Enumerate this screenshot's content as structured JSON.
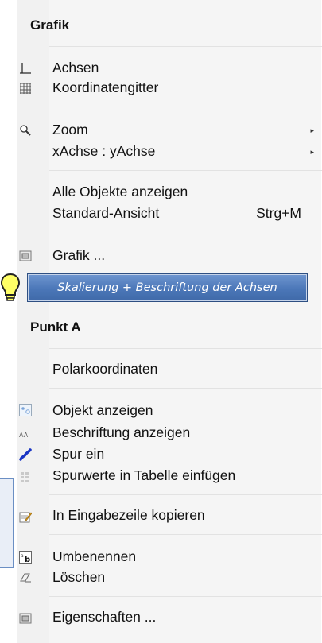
{
  "grafik_title": "Grafik",
  "achsen": "Achsen",
  "koordinatengitter": "Koordinatengitter",
  "zoom": "Zoom",
  "xachse_yachse": "xAchse : yAchse",
  "alle_objekte": "Alle Objekte anzeigen",
  "standard_ansicht": "Standard-Ansicht",
  "standard_shortcut": "Strg+M",
  "grafik_dialog": "Grafik ...",
  "tooltip": "Skalierung + Beschriftung  der Achsen",
  "punkt_title": "Punkt A",
  "polarkoordinaten": "Polarkoordinaten",
  "objekt_anzeigen": "Objekt anzeigen",
  "beschriftung_anzeigen": "Beschriftung anzeigen",
  "spur_ein": "Spur ein",
  "spurwerte": "Spurwerte in Tabelle einfügen",
  "eingabezeile": "In Eingabezeile kopieren",
  "umbenennen": "Umbenennen",
  "loeschen": "Löschen",
  "eigenschaften": "Eigenschaften ...",
  "submenu_arrow": "▸",
  "colors": {
    "tooltip_bg": "#4b77b8",
    "menu_bg": "#f5f5f5",
    "bulb": "#ffff66"
  }
}
